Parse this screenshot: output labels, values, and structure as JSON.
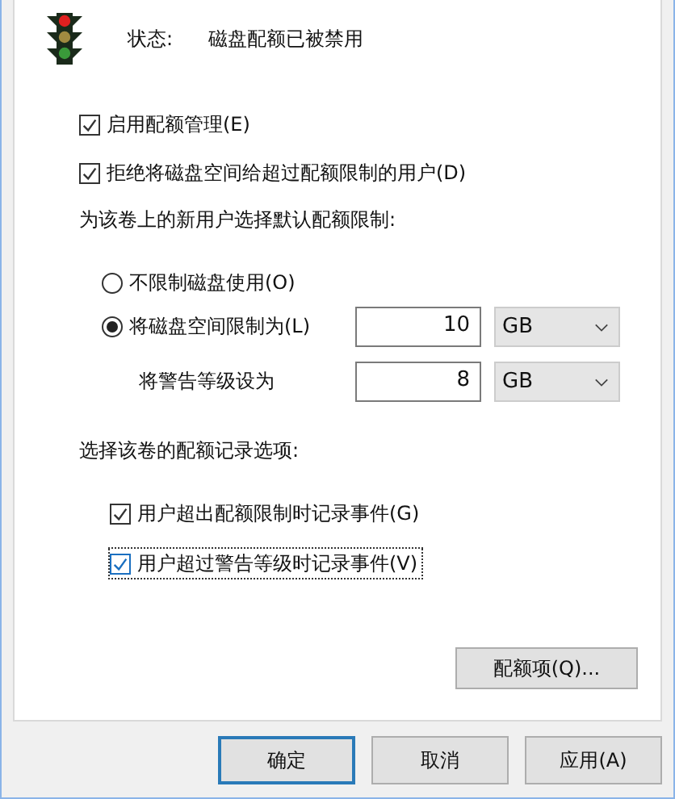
{
  "status": {
    "label": "状态:",
    "value": "磁盘配额已被禁用"
  },
  "options": [
    {
      "label": "启用配额管理(E)",
      "checked": true
    },
    {
      "label": "拒绝将磁盘空间给超过配额限制的用户(D)",
      "checked": true
    }
  ],
  "limit_section": {
    "heading": "为该卷上的新用户选择默认配额限制:",
    "radios": [
      {
        "label": "不限制磁盘使用(O)",
        "selected": false
      },
      {
        "label": "将磁盘空间限制为(L)",
        "selected": true
      }
    ],
    "limit": {
      "value": "10",
      "unit": "GB"
    },
    "warning": {
      "label": "将警告等级设为",
      "value": "8",
      "unit": "GB"
    }
  },
  "log_section": {
    "heading": "选择该卷的配额记录选项:",
    "options": [
      {
        "label": "用户超出配额限制时记录事件(G)",
        "checked": true,
        "focused": false
      },
      {
        "label": "用户超过警告等级时记录事件(V)",
        "checked": true,
        "focused": true
      }
    ]
  },
  "entries_button": "配额项(Q)...",
  "buttons": [
    {
      "label": "确定",
      "default": true
    },
    {
      "label": "取消",
      "default": false
    },
    {
      "label": "应用(A)",
      "default": false
    }
  ]
}
